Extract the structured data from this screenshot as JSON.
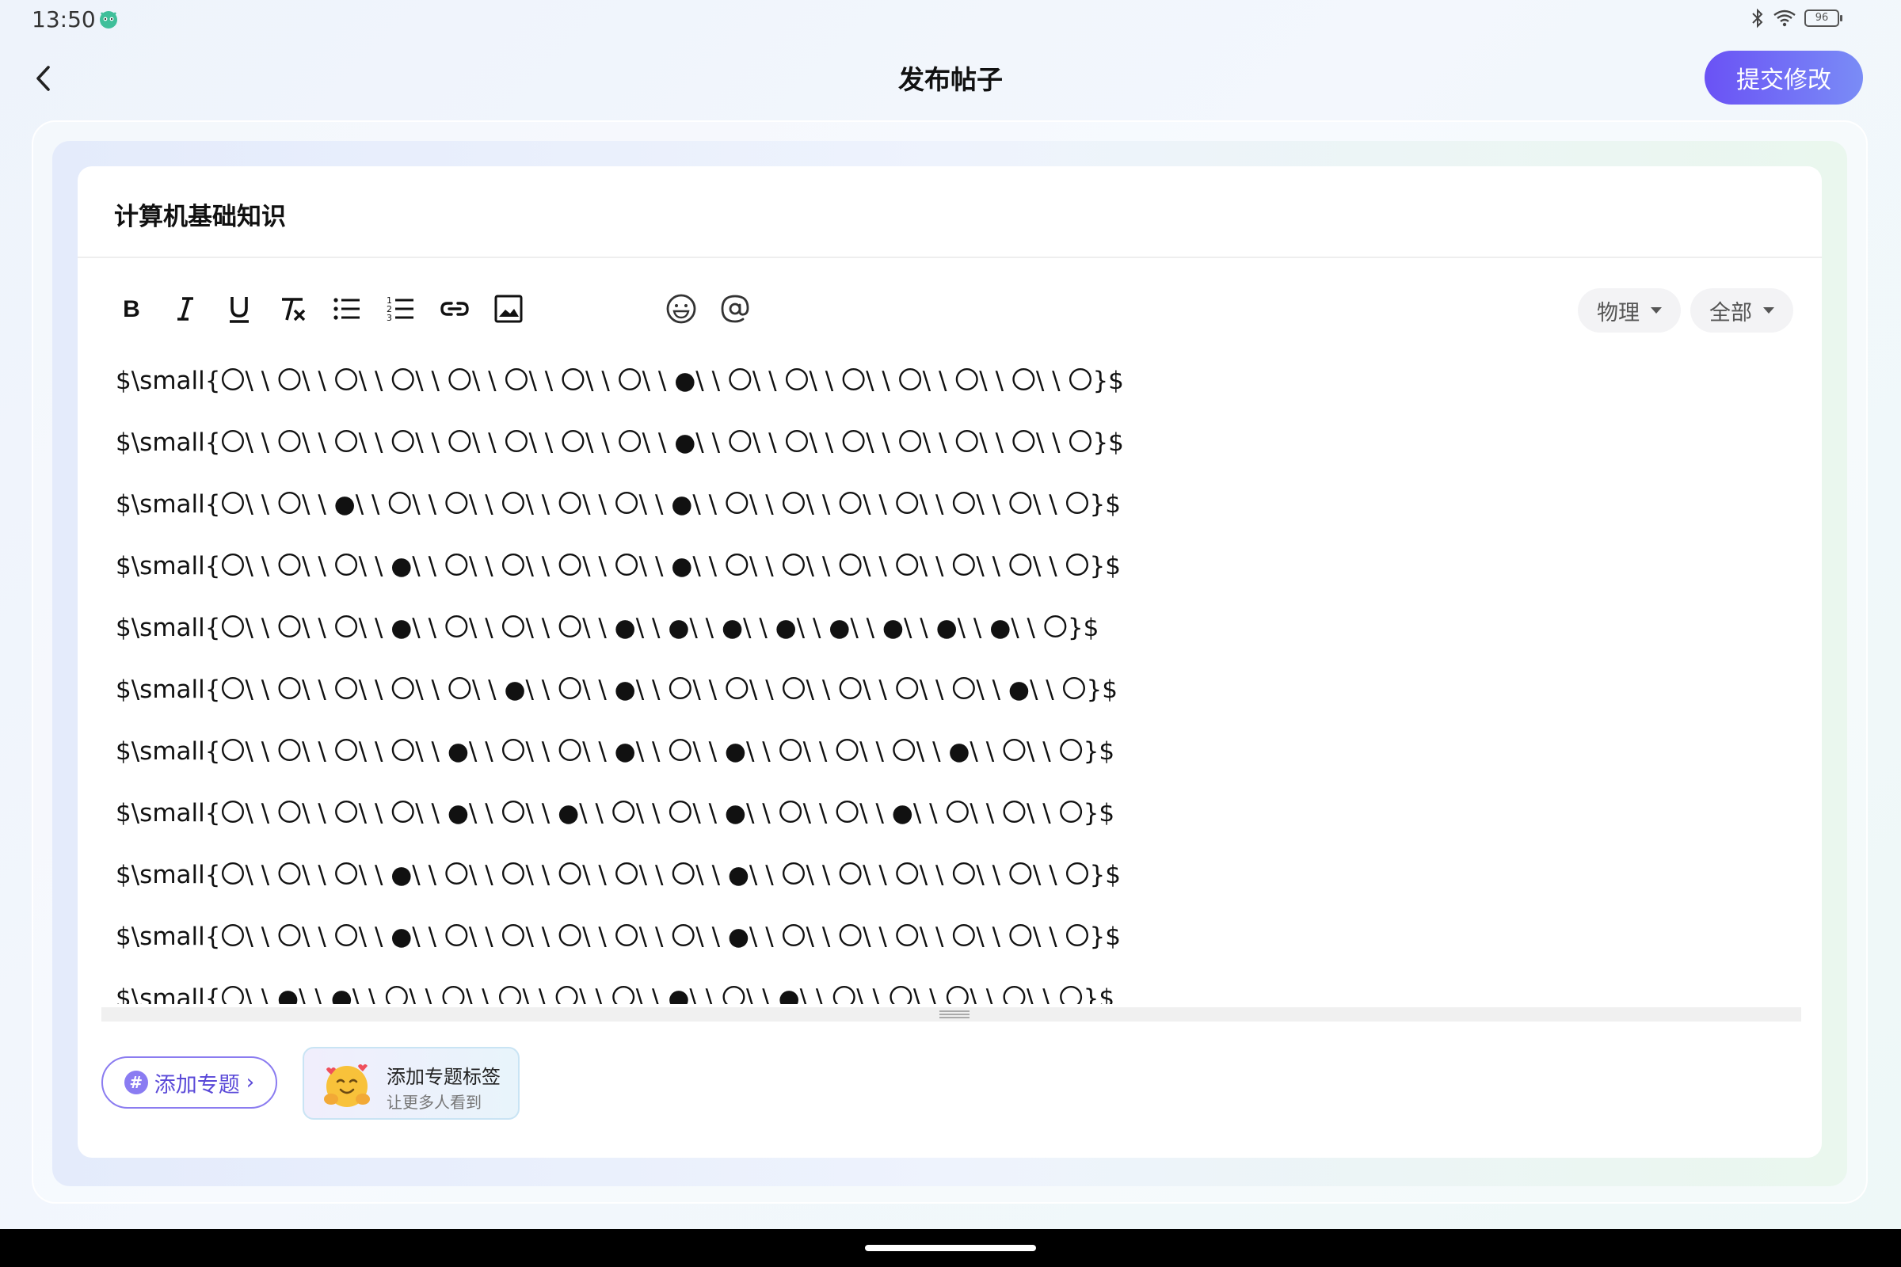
{
  "status": {
    "time": "13:50",
    "battery": "96"
  },
  "header": {
    "title": "发布帖子",
    "submit_label": "提交修改"
  },
  "post": {
    "title": "计算机基础知识"
  },
  "toolbar": {
    "tools": [
      "bold-icon",
      "italic-icon",
      "underline-icon",
      "clear-format-icon",
      "bullet-list-icon",
      "numbered-list-icon",
      "link-icon",
      "image-icon",
      "emoji-icon",
      "mention-icon"
    ],
    "category": "物理",
    "scope": "全部"
  },
  "content": {
    "lines": [
      "$\\small{〇\\ \\ 〇\\ \\ 〇\\ \\ 〇\\ \\ 〇\\ \\ 〇\\ \\ 〇\\ \\ 〇\\ \\ ●\\ \\ 〇\\ \\ 〇\\ \\ 〇\\ \\ 〇\\ \\ 〇\\ \\ 〇\\ \\ 〇}$",
      "$\\small{〇\\ \\ 〇\\ \\ 〇\\ \\ 〇\\ \\ 〇\\ \\ 〇\\ \\ 〇\\ \\ 〇\\ \\ ●\\ \\ 〇\\ \\ 〇\\ \\ 〇\\ \\ 〇\\ \\ 〇\\ \\ 〇\\ \\ 〇}$",
      "$\\small{〇\\ \\ 〇\\ \\ ●\\ \\ 〇\\ \\ 〇\\ \\ 〇\\ \\ 〇\\ \\ 〇\\ \\ ●\\ \\ 〇\\ \\ 〇\\ \\ 〇\\ \\ 〇\\ \\ 〇\\ \\ 〇\\ \\ 〇}$",
      "$\\small{〇\\ \\ 〇\\ \\ 〇\\ \\ ●\\ \\ 〇\\ \\ 〇\\ \\ 〇\\ \\ 〇\\ \\ ●\\ \\ 〇\\ \\ 〇\\ \\ 〇\\ \\ 〇\\ \\ 〇\\ \\ 〇\\ \\ 〇}$",
      "$\\small{〇\\ \\ 〇\\ \\ 〇\\ \\ ●\\ \\ 〇\\ \\ 〇\\ \\ 〇\\ \\ ●\\ \\ ●\\ \\ ●\\ \\ ●\\ \\ ●\\ \\ ●\\ \\ ●\\ \\ ●\\ \\ 〇}$",
      "$\\small{〇\\ \\ 〇\\ \\ 〇\\ \\ 〇\\ \\ 〇\\ \\ ●\\ \\ 〇\\ \\ ●\\ \\ 〇\\ \\ 〇\\ \\ 〇\\ \\ 〇\\ \\ 〇\\ \\ 〇\\ \\ ●\\ \\ 〇}$",
      "$\\small{〇\\ \\ 〇\\ \\ 〇\\ \\ 〇\\ \\ ●\\ \\ 〇\\ \\ 〇\\ \\ ●\\ \\ 〇\\ \\ ●\\ \\ 〇\\ \\ 〇\\ \\ 〇\\ \\ ●\\ \\ 〇\\ \\ 〇}$",
      "$\\small{〇\\ \\ 〇\\ \\ 〇\\ \\ 〇\\ \\ ●\\ \\ 〇\\ \\ ●\\ \\ 〇\\ \\ 〇\\ \\ ●\\ \\ 〇\\ \\ 〇\\ \\ ●\\ \\ 〇\\ \\ 〇\\ \\ 〇}$",
      "$\\small{〇\\ \\ 〇\\ \\ 〇\\ \\ ●\\ \\ 〇\\ \\ 〇\\ \\ 〇\\ \\ 〇\\ \\ 〇\\ \\ ●\\ \\ 〇\\ \\ 〇\\ \\ 〇\\ \\ 〇\\ \\ 〇\\ \\ 〇}$",
      "$\\small{〇\\ \\ 〇\\ \\ 〇\\ \\ ●\\ \\ 〇\\ \\ 〇\\ \\ 〇\\ \\ 〇\\ \\ 〇\\ \\ ●\\ \\ 〇\\ \\ 〇\\ \\ 〇\\ \\ 〇\\ \\ 〇\\ \\ 〇}$",
      "$\\small{〇\\ \\ ●\\ \\ ●\\ \\ 〇\\ \\ 〇\\ \\ 〇\\ \\ 〇\\ \\ 〇\\ \\ ●\\ \\ 〇\\ \\ ●\\ \\ 〇\\ \\ 〇\\ \\ 〇\\ \\ 〇\\ \\ 〇}$"
    ]
  },
  "topic": {
    "add_label": "添加专题",
    "tip_title": "添加专题标签",
    "tip_subtitle": "让更多人看到"
  }
}
